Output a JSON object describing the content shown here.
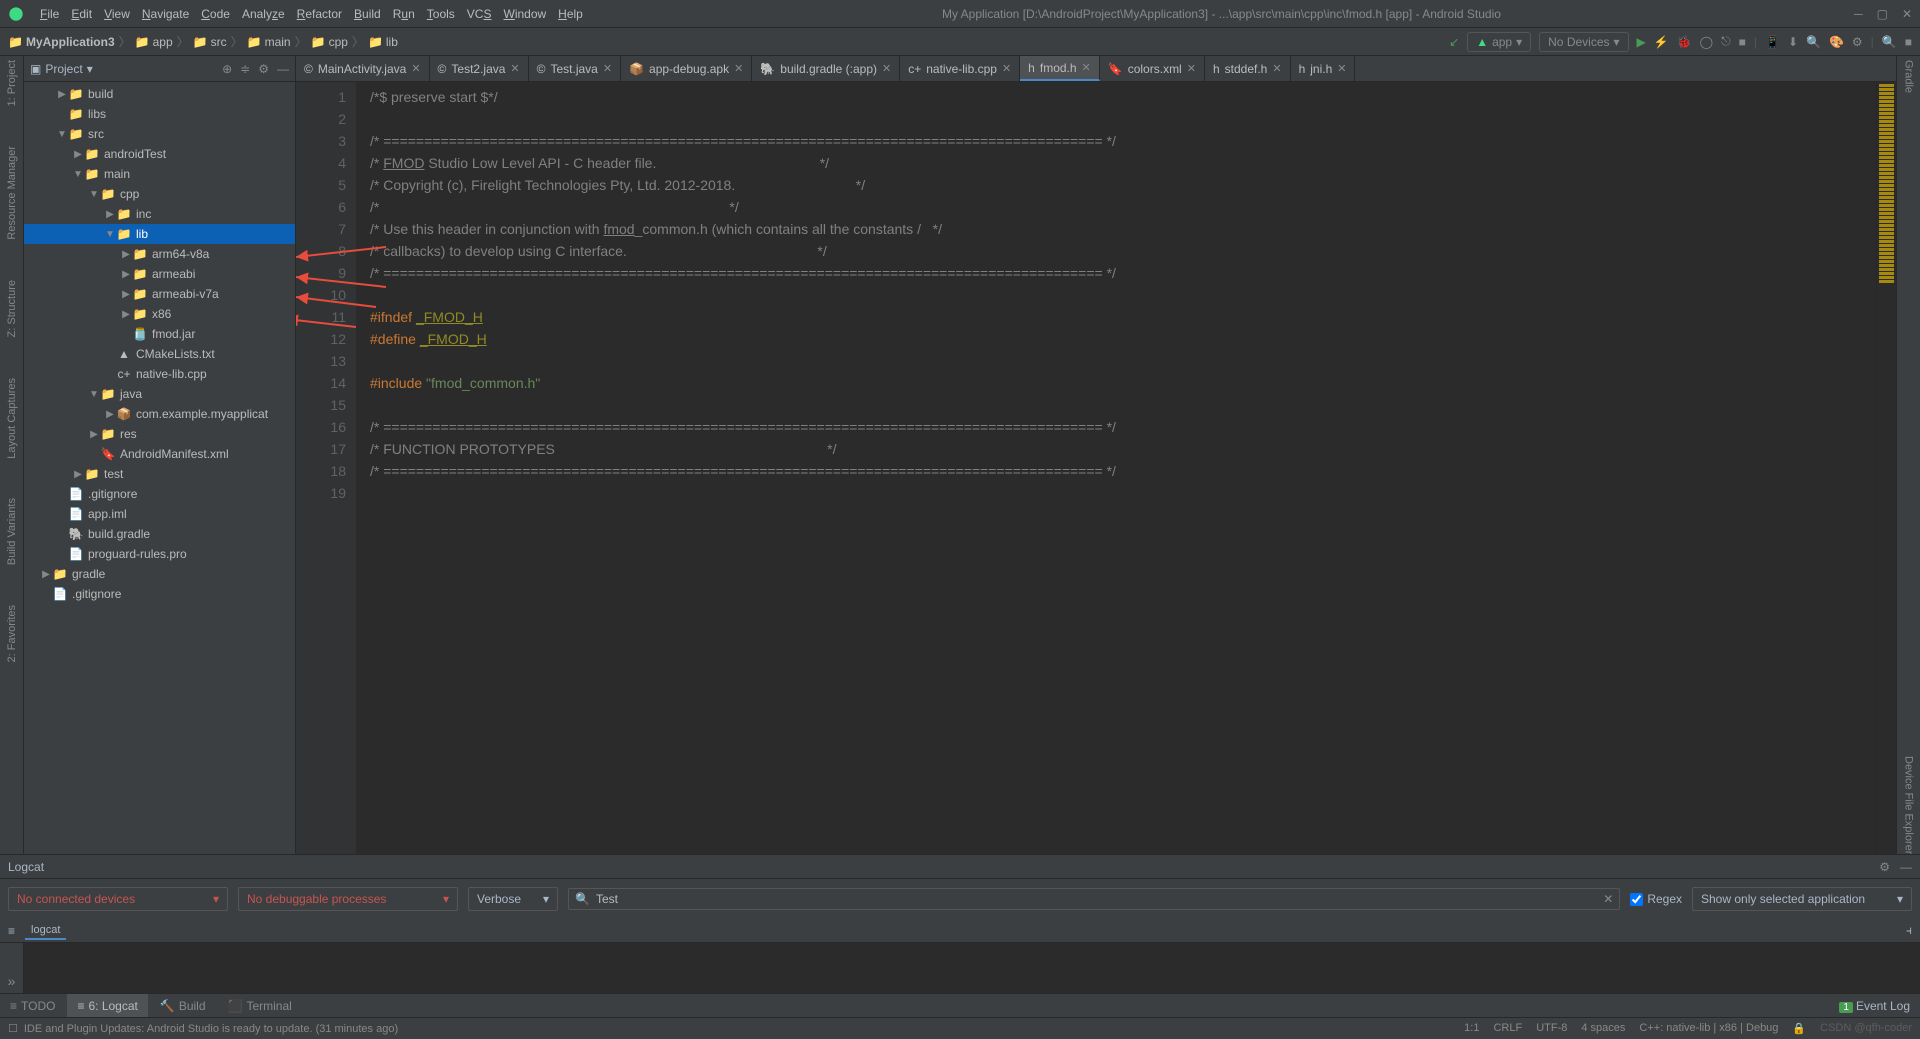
{
  "menubar": [
    "File",
    "Edit",
    "View",
    "Navigate",
    "Code",
    "Analyze",
    "Refactor",
    "Build",
    "Run",
    "Tools",
    "VCS",
    "Window",
    "Help"
  ],
  "window_title": "My Application [D:\\AndroidProject\\MyApplication3] - ...\\app\\src\\main\\cpp\\inc\\fmod.h [app] - Android Studio",
  "breadcrumbs": [
    "MyApplication3",
    "app",
    "src",
    "main",
    "cpp",
    "lib"
  ],
  "run_config": "app",
  "device_selector": "No Devices",
  "sidebar": {
    "title": "Project"
  },
  "left_tools": [
    "1: Project",
    "Resource Manager",
    "Z: Structure",
    "Layout Captures",
    "Build Variants",
    "2: Favorites"
  ],
  "right_tools": [
    "Gradle",
    "Device File Explorer"
  ],
  "tree": [
    {
      "indent": 2,
      "arrow": "right",
      "icon": "📁",
      "label": "build",
      "color": "#c87c3c"
    },
    {
      "indent": 2,
      "arrow": "",
      "icon": "📁",
      "label": "libs",
      "color": "#808080"
    },
    {
      "indent": 2,
      "arrow": "down",
      "icon": "📁",
      "label": "src",
      "color": "#808080"
    },
    {
      "indent": 3,
      "arrow": "right",
      "icon": "📁",
      "label": "androidTest",
      "color": "#808080"
    },
    {
      "indent": 3,
      "arrow": "down",
      "icon": "📁",
      "label": "main",
      "color": "#808080"
    },
    {
      "indent": 4,
      "arrow": "down",
      "icon": "📁",
      "label": "cpp",
      "color": "#808080"
    },
    {
      "indent": 5,
      "arrow": "right",
      "icon": "📁",
      "label": "inc",
      "color": "#808080"
    },
    {
      "indent": 5,
      "arrow": "down",
      "icon": "📁",
      "label": "lib",
      "color": "#808080",
      "selected": true
    },
    {
      "indent": 6,
      "arrow": "right",
      "icon": "📁",
      "label": "arm64-v8a",
      "color": "#808080"
    },
    {
      "indent": 6,
      "arrow": "right",
      "icon": "📁",
      "label": "armeabi",
      "color": "#808080"
    },
    {
      "indent": 6,
      "arrow": "right",
      "icon": "📁",
      "label": "armeabi-v7a",
      "color": "#808080"
    },
    {
      "indent": 6,
      "arrow": "right",
      "icon": "📁",
      "label": "x86",
      "color": "#808080"
    },
    {
      "indent": 6,
      "arrow": "",
      "icon": "🫙",
      "label": "fmod.jar",
      "color": "#bbb"
    },
    {
      "indent": 5,
      "arrow": "",
      "icon": "▲",
      "label": "CMakeLists.txt",
      "color": "#bbb"
    },
    {
      "indent": 5,
      "arrow": "",
      "icon": "c+",
      "label": "native-lib.cpp",
      "color": "#bbb"
    },
    {
      "indent": 4,
      "arrow": "down",
      "icon": "📁",
      "label": "java",
      "color": "#808080"
    },
    {
      "indent": 5,
      "arrow": "right",
      "icon": "📦",
      "label": "com.example.myapplicat",
      "color": "#808080"
    },
    {
      "indent": 4,
      "arrow": "right",
      "icon": "📁",
      "label": "res",
      "color": "#808080"
    },
    {
      "indent": 4,
      "arrow": "",
      "icon": "🔖",
      "label": "AndroidManifest.xml",
      "color": "#bbb"
    },
    {
      "indent": 3,
      "arrow": "right",
      "icon": "📁",
      "label": "test",
      "color": "#808080"
    },
    {
      "indent": 2,
      "arrow": "",
      "icon": "📄",
      "label": ".gitignore",
      "color": "#bbb"
    },
    {
      "indent": 2,
      "arrow": "",
      "icon": "📄",
      "label": "app.iml",
      "color": "#bbb"
    },
    {
      "indent": 2,
      "arrow": "",
      "icon": "🐘",
      "label": "build.gradle",
      "color": "#bbb"
    },
    {
      "indent": 2,
      "arrow": "",
      "icon": "📄",
      "label": "proguard-rules.pro",
      "color": "#bbb"
    },
    {
      "indent": 1,
      "arrow": "right",
      "icon": "📁",
      "label": "gradle",
      "color": "#808080"
    },
    {
      "indent": 1,
      "arrow": "",
      "icon": "📄",
      "label": ".gitignore",
      "color": "#bbb"
    }
  ],
  "tabs": [
    {
      "icon": "©",
      "label": "MainActivity.java"
    },
    {
      "icon": "©",
      "label": "Test2.java"
    },
    {
      "icon": "©",
      "label": "Test.java"
    },
    {
      "icon": "📦",
      "label": "app-debug.apk"
    },
    {
      "icon": "🐘",
      "label": "build.gradle (:app)"
    },
    {
      "icon": "c+",
      "label": "native-lib.cpp"
    },
    {
      "icon": "h",
      "label": "fmod.h",
      "active": true
    },
    {
      "icon": "🔖",
      "label": "colors.xml"
    },
    {
      "icon": "h",
      "label": "stddef.h"
    },
    {
      "icon": "h",
      "label": "jni.h"
    }
  ],
  "code_lines": [
    1,
    2,
    3,
    4,
    5,
    6,
    7,
    8,
    9,
    10,
    11,
    12,
    13,
    14,
    15,
    16,
    17,
    18,
    19
  ],
  "code": {
    "l1": "/*$ preserve start $*/",
    "l3": "/* ======================================================================================== */",
    "l4a": "/* ",
    "l4b": "FMOD",
    "l4c": " Studio Low Level API - C header file.                                          */",
    "l5": "/* Copyright (c), Firelight Technologies Pty, Ltd. 2012-2018.                               */",
    "l6": "/*                                                                                          */",
    "l7a": "/* Use this header in conjunction with ",
    "l7b": "fmod",
    "l7c": "_common.h (which contains all the constants /   */",
    "l8": "/* callbacks) to develop using C interface.                                                 */",
    "l9": "/* ======================================================================================== */",
    "l11a": "#ifndef ",
    "l11b": "_FMOD_H",
    "l12a": "#define ",
    "l12b": "_FMOD_H",
    "l14a": "#include ",
    "l14b": "\"fmod_common.h\"",
    "l16": "/* ======================================================================================== */",
    "l17": "/* FUNCTION PROTOTYPES                                                                      */",
    "l18": "/* ======================================================================================== */"
  },
  "logcat": {
    "title": "Logcat",
    "devices": "No connected devices",
    "processes": "No debuggable processes",
    "level": "Verbose",
    "search": "Test",
    "regex": "Regex",
    "filter": "Show only selected application",
    "tab": "logcat"
  },
  "bottom_tabs": [
    {
      "icon": "≡",
      "label": "TODO"
    },
    {
      "icon": "≡",
      "label": "6: Logcat",
      "active": true
    },
    {
      "icon": "🔨",
      "label": "Build"
    },
    {
      "icon": "⬛",
      "label": "Terminal"
    }
  ],
  "event_log": "Event Log",
  "status": {
    "msg": "IDE and Plugin Updates: Android Studio is ready to update. (31 minutes ago)",
    "pos": "1:1",
    "sep": "CRLF",
    "enc": "UTF-8",
    "indent": "4 spaces",
    "context": "C++: native-lib | x86 | Debug",
    "watermark": "CSDN @qfh-coder"
  }
}
